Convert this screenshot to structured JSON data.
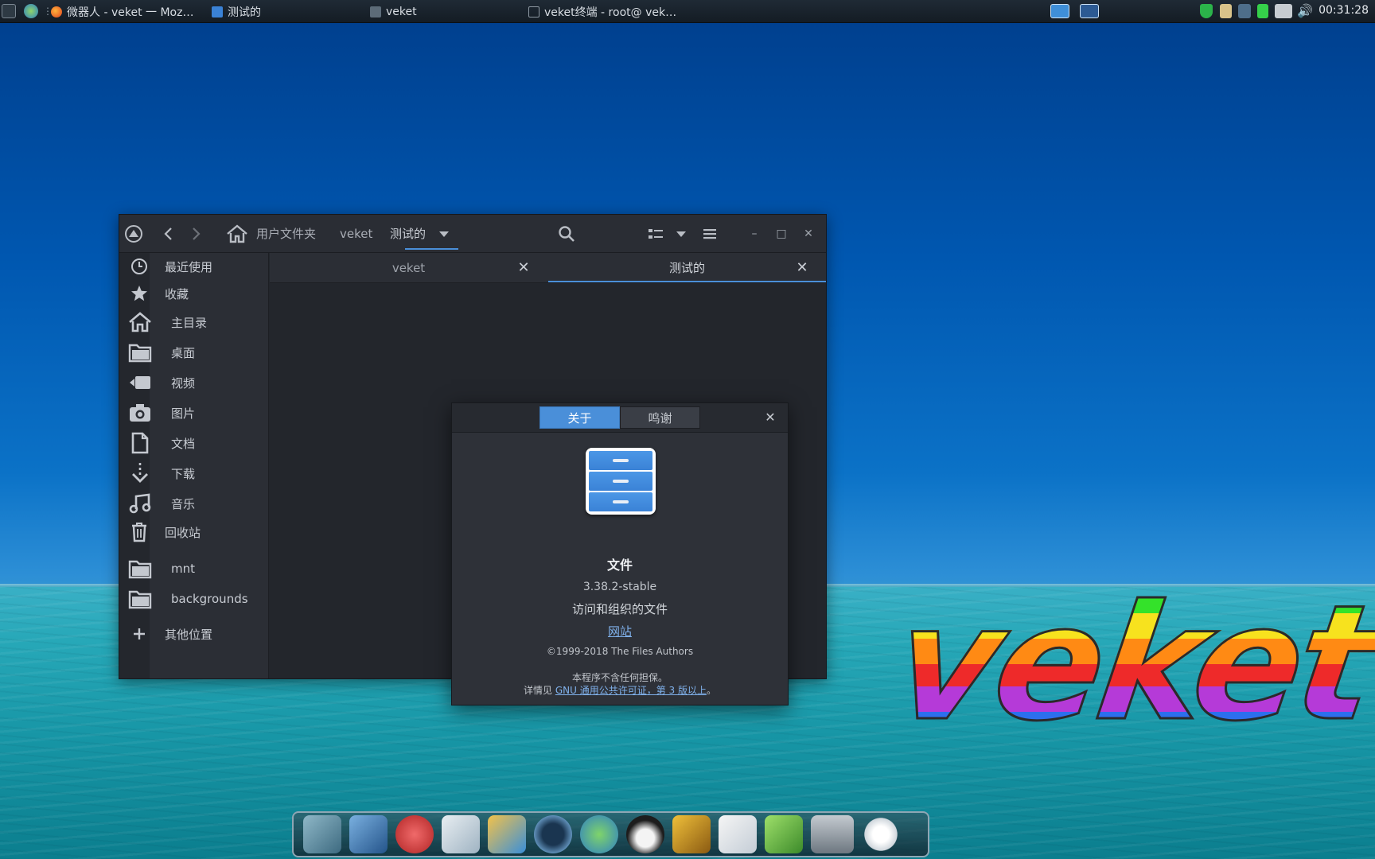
{
  "top_panel": {
    "tasks": [
      {
        "label": "微器人 - veket 一 Moz…"
      },
      {
        "label": "测试的"
      },
      {
        "label": "veket"
      },
      {
        "label": "veket终端 - root@ vek…"
      }
    ],
    "clock": "00:31:28"
  },
  "file_manager": {
    "breadcrumbs": [
      "用户文件夹",
      "veket",
      "测试的"
    ],
    "tabs": [
      {
        "label": "veket"
      },
      {
        "label": "测试的"
      }
    ],
    "sidebar": {
      "items": [
        {
          "label": "最近使用",
          "icon": "clock-icon"
        },
        {
          "label": "收藏",
          "icon": "star-icon"
        },
        {
          "label": "主目录",
          "icon": "home-icon"
        },
        {
          "label": "桌面",
          "icon": "folder-icon"
        },
        {
          "label": "视频",
          "icon": "video-icon"
        },
        {
          "label": "图片",
          "icon": "camera-icon"
        },
        {
          "label": "文档",
          "icon": "document-icon"
        },
        {
          "label": "下载",
          "icon": "download-icon"
        },
        {
          "label": "音乐",
          "icon": "music-icon"
        },
        {
          "label": "回收站",
          "icon": "trash-icon"
        },
        {
          "label": "mnt",
          "icon": "folder-icon"
        },
        {
          "label": "backgrounds",
          "icon": "folder-icon"
        },
        {
          "label": "其他位置",
          "icon": "plus-icon"
        }
      ]
    }
  },
  "about_dialog": {
    "tabs": [
      "关于",
      "鸣谢"
    ],
    "app_name": "文件",
    "version": "3.38.2-stable",
    "description": "访问和组织的文件",
    "website": "网站",
    "copyright": "©1999-2018 The Files Authors",
    "warranty": "本程序不含任何担保。",
    "license_prefix": "详情见 ",
    "license_link": "GNU 通用公共许可证，第 3 版以上",
    "license_suffix": "。"
  },
  "wallpaper_logo": "veket",
  "colors": {
    "accent": "#4a8fd9",
    "window_bg": "#23262c",
    "sidebar_bg": "#2b2e35"
  }
}
